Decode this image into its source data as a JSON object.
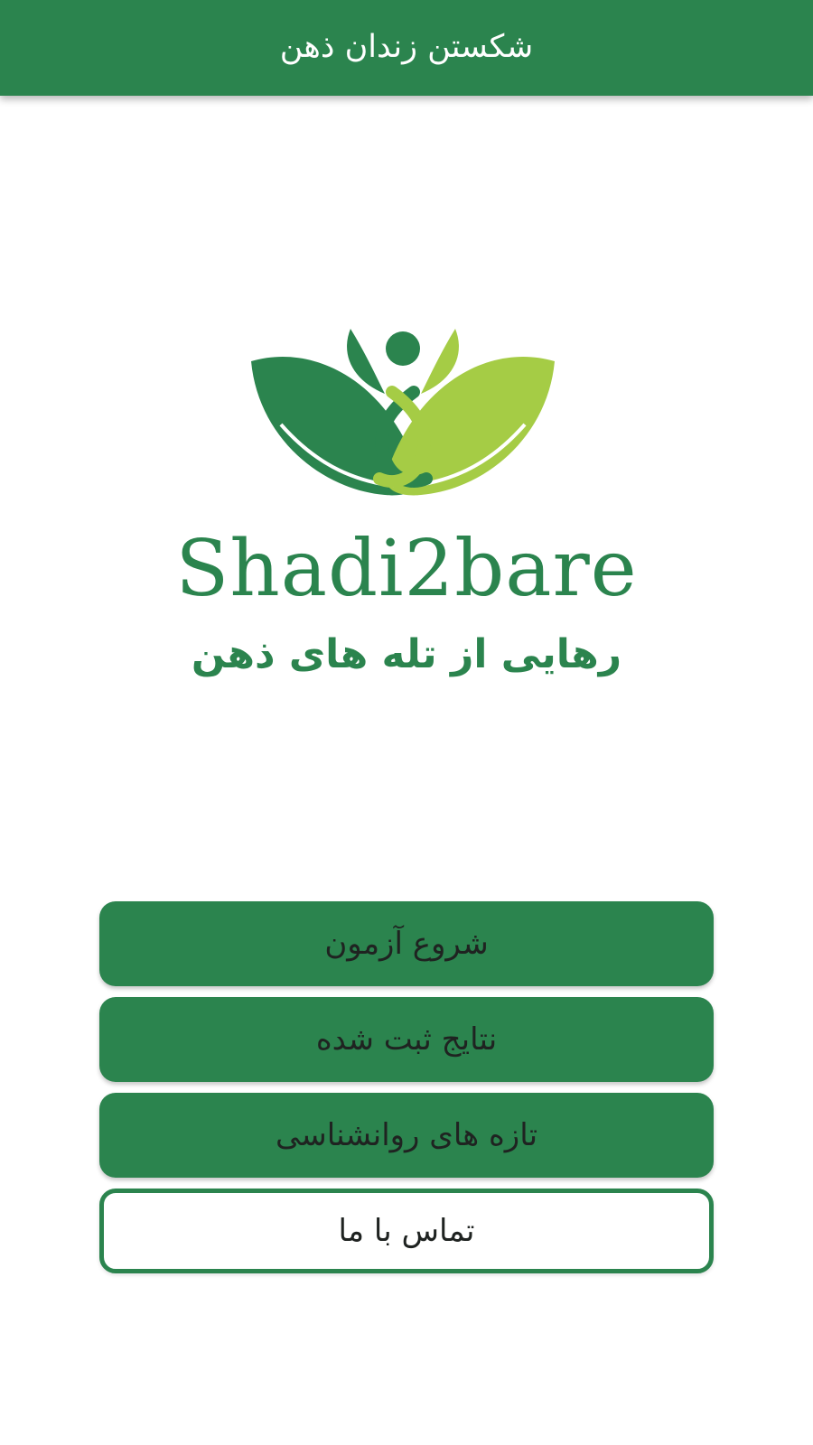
{
  "app_bar": {
    "title": "شکستن زندان ذهن"
  },
  "logo": {
    "wordmark": "Shadi2bare",
    "tagline": "رهایی از تله های ذهن"
  },
  "menu": {
    "items": [
      {
        "label": "شروع آزمون"
      },
      {
        "label": "نتایج ثبت شده"
      },
      {
        "label": "تازه های روانشناسی"
      },
      {
        "label": "تماس با ما"
      }
    ]
  },
  "colors": {
    "primary": "#2b844e",
    "leaf_light": "#a5cc45",
    "button_text": "#1f2321",
    "background": "#ffffff"
  }
}
